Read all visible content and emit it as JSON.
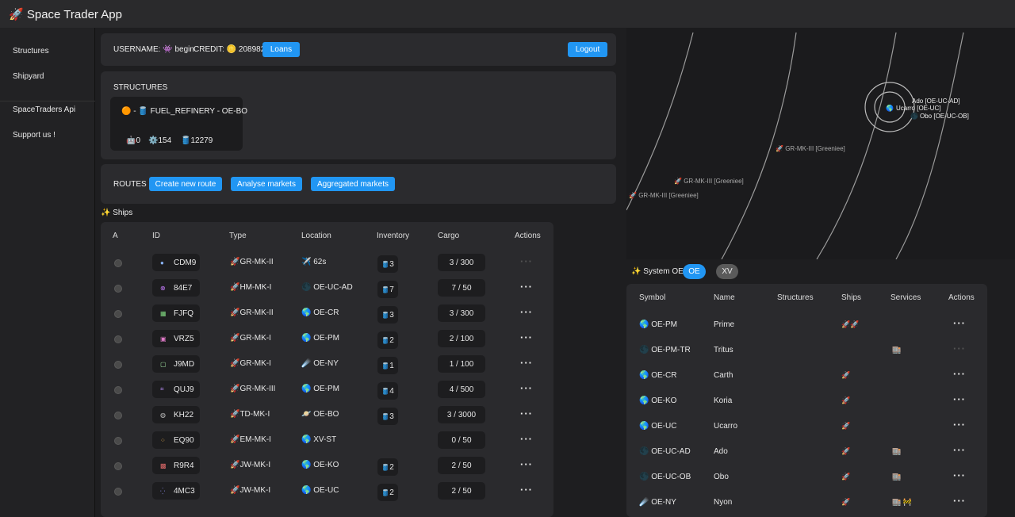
{
  "app": {
    "icon": "🚀",
    "title": "Space Trader App"
  },
  "sidebar": {
    "items": [
      {
        "label": "Structures"
      },
      {
        "label": "Shipyard"
      },
      {
        "label": "SpaceTraders Api"
      },
      {
        "label": "Support us !"
      }
    ]
  },
  "user": {
    "username_label": "USERNAME:",
    "username_icon": "👾",
    "username": "begin",
    "credit_label": "CREDIT:",
    "credit_icon": "🪙",
    "credit": "208982",
    "loans_button": "Loans",
    "logout_button": "Logout"
  },
  "structures": {
    "title": "STRUCTURES",
    "item": {
      "status_icon": "🟠",
      "separator": "-",
      "type_icon": "🛢️",
      "name": "FUEL_REFINERY - OE-BO",
      "stats": [
        {
          "icon": "🤖",
          "value": "0"
        },
        {
          "icon": "⚙️",
          "value": "154"
        },
        {
          "icon": "🛢️",
          "value": "12279"
        }
      ]
    }
  },
  "routes": {
    "title": "ROUTES",
    "create_button": "Create new route",
    "analyse_button": "Analyse markets",
    "aggregated_button": "Aggregated markets"
  },
  "ships": {
    "title": "✨ Ships",
    "headers": [
      "A",
      "ID",
      "Type",
      "Location",
      "Inventory",
      "Cargo",
      "Actions"
    ],
    "rows": [
      {
        "icon": "●",
        "icon_color": "#8ab4f8",
        "id": "CDM9",
        "type": "🚀GR-MK-II",
        "loc_icon": "✈️",
        "location": "62s",
        "inventory": "3",
        "cargo": "3 / 300",
        "actions": "···"
      },
      {
        "icon": "⊗",
        "icon_color": "#c77dff",
        "id": "84E7",
        "type": "🚀HM-MK-I",
        "loc_icon": "🌑",
        "location": "OE-UC-AD",
        "inventory": "7",
        "cargo": "7 / 50",
        "actions": "···"
      },
      {
        "icon": "▦",
        "icon_color": "#7fd67f",
        "id": "FJFQ",
        "type": "🚀GR-MK-II",
        "loc_icon": "🌎",
        "location": "OE-CR",
        "inventory": "3",
        "cargo": "3 / 300",
        "actions": "···"
      },
      {
        "icon": "▣",
        "icon_color": "#e07ac8",
        "id": "VRZ5",
        "type": "🚀GR-MK-I",
        "loc_icon": "🌎",
        "location": "OE-PM",
        "inventory": "2",
        "cargo": "2 / 100",
        "actions": "···"
      },
      {
        "icon": "▢",
        "icon_color": "#9fe09f",
        "id": "J9MD",
        "type": "🚀GR-MK-I",
        "loc_icon": "☄️",
        "location": "OE-NY",
        "inventory": "1",
        "cargo": "1 / 100",
        "actions": "···"
      },
      {
        "icon": "⌗",
        "icon_color": "#b68cf5",
        "id": "QUJ9",
        "type": "🚀GR-MK-III",
        "loc_icon": "🌎",
        "location": "OE-PM",
        "inventory": "4",
        "cargo": "4 / 500",
        "actions": "···"
      },
      {
        "icon": "◍",
        "icon_color": "#bbbbbb",
        "id": "KH22",
        "type": "🚀TD-MK-I",
        "loc_icon": "🪐",
        "location": "OE-BO",
        "inventory": "3",
        "cargo": "3 / 3000",
        "actions": "···"
      },
      {
        "icon": "⁘",
        "icon_color": "#e0a84a",
        "id": "EQ90",
        "type": "🚀EM-MK-I",
        "loc_icon": "🌎",
        "location": "XV-ST",
        "inventory": "",
        "cargo": "0 / 50",
        "actions": "···"
      },
      {
        "icon": "▩",
        "icon_color": "#e06a6a",
        "id": "R9R4",
        "type": "🚀JW-MK-I",
        "loc_icon": "🌎",
        "location": "OE-KO",
        "inventory": "2",
        "cargo": "2 / 50",
        "actions": "···"
      },
      {
        "icon": "⁛",
        "icon_color": "#8a8ae6",
        "id": "4MC3",
        "type": "🚀JW-MK-I",
        "loc_icon": "🌎",
        "location": "OE-UC",
        "inventory": "2",
        "cargo": "2 / 50",
        "actions": "···"
      }
    ]
  },
  "map": {
    "center_label": "Ucarro [OE-UC]",
    "moon1_label": "Ado [OE-UC-AD]",
    "moon2_label": "Obo [OE-UC-OB]",
    "ship_labels": [
      "GR-MK-III [Greeniee]",
      "GR-MK-III [Greeniee]",
      "GR-MK-III [Greeniee]"
    ]
  },
  "system": {
    "title": "✨ System OE",
    "chips": [
      {
        "label": "OE",
        "active": true
      },
      {
        "label": "XV",
        "active": false
      }
    ],
    "headers": [
      "Symbol",
      "Name",
      "Structures",
      "Ships",
      "Services",
      "Actions"
    ],
    "rows": [
      {
        "icon": "🌎",
        "symbol": "OE-PM",
        "name": "Prime",
        "structures": "",
        "ships": "🚀🚀",
        "services": "",
        "actions": "···"
      },
      {
        "icon": "🌑",
        "symbol": "OE-PM-TR",
        "name": "Tritus",
        "structures": "",
        "ships": "",
        "services": "🏬",
        "actions": "···"
      },
      {
        "icon": "🌎",
        "symbol": "OE-CR",
        "name": "Carth",
        "structures": "",
        "ships": "🚀",
        "services": "",
        "actions": "···"
      },
      {
        "icon": "🌎",
        "symbol": "OE-KO",
        "name": "Koria",
        "structures": "",
        "ships": "🚀",
        "services": "",
        "actions": "···"
      },
      {
        "icon": "🌎",
        "symbol": "OE-UC",
        "name": "Ucarro",
        "structures": "",
        "ships": "🚀",
        "services": "",
        "actions": "···"
      },
      {
        "icon": "🌑",
        "symbol": "OE-UC-AD",
        "name": "Ado",
        "structures": "",
        "ships": "🚀",
        "services": "🏬",
        "actions": "···"
      },
      {
        "icon": "🌑",
        "symbol": "OE-UC-OB",
        "name": "Obo",
        "structures": "",
        "ships": "🚀",
        "services": "🏬",
        "actions": "···"
      },
      {
        "icon": "☄️",
        "symbol": "OE-NY",
        "name": "Nyon",
        "structures": "",
        "ships": "🚀",
        "services": "🏬 🚧",
        "actions": "···"
      }
    ]
  }
}
